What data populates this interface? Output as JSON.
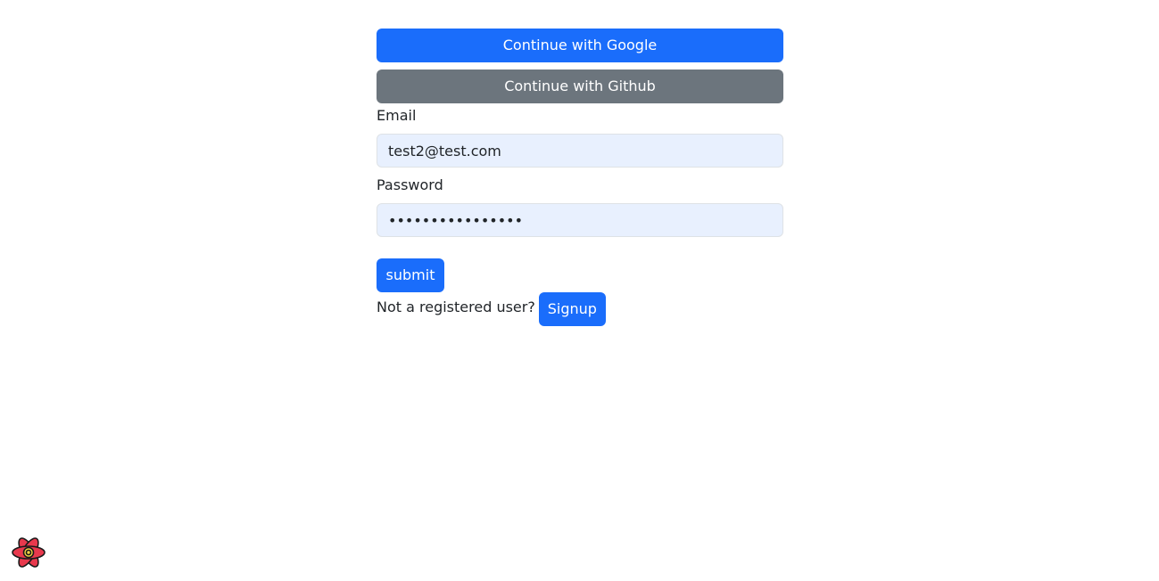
{
  "auth": {
    "google_button_label": "Continue with Google",
    "github_button_label": "Continue with Github"
  },
  "form": {
    "email_label": "Email",
    "email_value": "test2@test.com",
    "password_label": "Password",
    "password_value": "••••••••••••••••",
    "submit_label": "submit"
  },
  "signup": {
    "prompt_text": "Not a registered user?",
    "button_label": "Signup"
  },
  "icons": {
    "devtools_logo": "react-logo-icon"
  },
  "colors": {
    "primary": "#1a6dfb",
    "secondary": "#6c757d",
    "input_bg": "#e8f0fe",
    "logo_fill": "#e8394d",
    "logo_center": "#f5d442"
  }
}
